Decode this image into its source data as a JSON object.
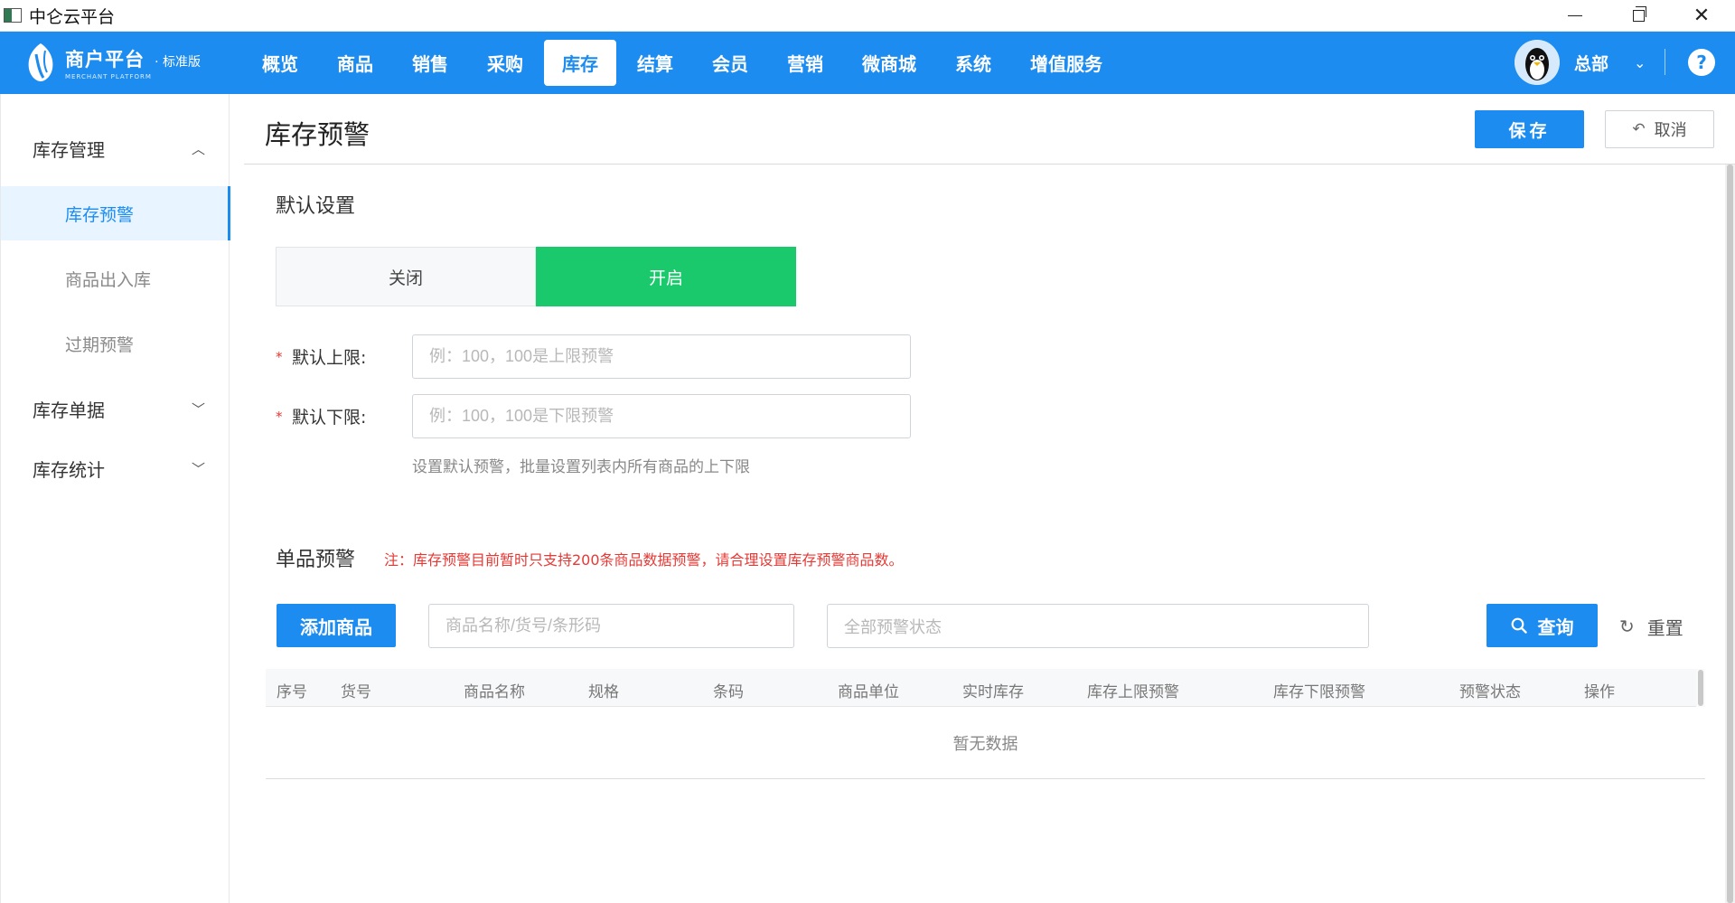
{
  "window": {
    "title": "中仑云平台"
  },
  "brand": {
    "name": "商户平台",
    "edition": "· 标准版",
    "subtitle": "MERCHANT PLATFORM"
  },
  "nav": {
    "items": [
      {
        "label": "概览"
      },
      {
        "label": "商品"
      },
      {
        "label": "销售"
      },
      {
        "label": "采购"
      },
      {
        "label": "库存",
        "active": true
      },
      {
        "label": "结算"
      },
      {
        "label": "会员"
      },
      {
        "label": "营销"
      },
      {
        "label": "微商城"
      },
      {
        "label": "系统"
      },
      {
        "label": "增值服务"
      }
    ],
    "user_name": "总部",
    "user_chevron": "⌄",
    "help": "?"
  },
  "sidebar": {
    "groups": [
      {
        "label": "库存管理",
        "expanded": true
      },
      {
        "label": "库存单据",
        "expanded": false
      },
      {
        "label": "库存统计",
        "expanded": false
      }
    ],
    "items": [
      {
        "label": "库存预警",
        "active": true
      },
      {
        "label": "商品出入库"
      },
      {
        "label": "过期预警"
      }
    ]
  },
  "header": {
    "title": "库存预警",
    "save_label": "保存",
    "cancel_label": "取消"
  },
  "defaults": {
    "section_title": "默认设置",
    "toggle_off": "关闭",
    "toggle_on": "开启",
    "upper": {
      "required_mark": "*",
      "label": "默认上限:",
      "value": "",
      "placeholder": "例：100，100是上限预警"
    },
    "lower": {
      "required_mark": "*",
      "label": "默认下限:",
      "value": "",
      "placeholder": "例：100，100是下限预警"
    },
    "hint": "设置默认预警，批量设置列表内所有商品的上下限"
  },
  "single": {
    "section_title": "单品预警",
    "notice": "注：库存预警目前暂时只支持200条商品数据预警，请合理设置库存预警商品数。",
    "add_label": "添加商品",
    "search_placeholder": "商品名称/货号/条形码",
    "status_placeholder": "全部预警状态",
    "query_label": "查询",
    "reset_label": "重置",
    "columns": [
      "序号",
      "货号",
      "商品名称",
      "规格",
      "条码",
      "商品单位",
      "实时库存",
      "库存上限预警",
      "库存下限预警",
      "预警状态",
      "操作"
    ],
    "empty_text": "暂无数据"
  },
  "colors": {
    "primary": "#1d8cf0",
    "toggle_on": "#19c96b",
    "notice": "#e53935"
  }
}
